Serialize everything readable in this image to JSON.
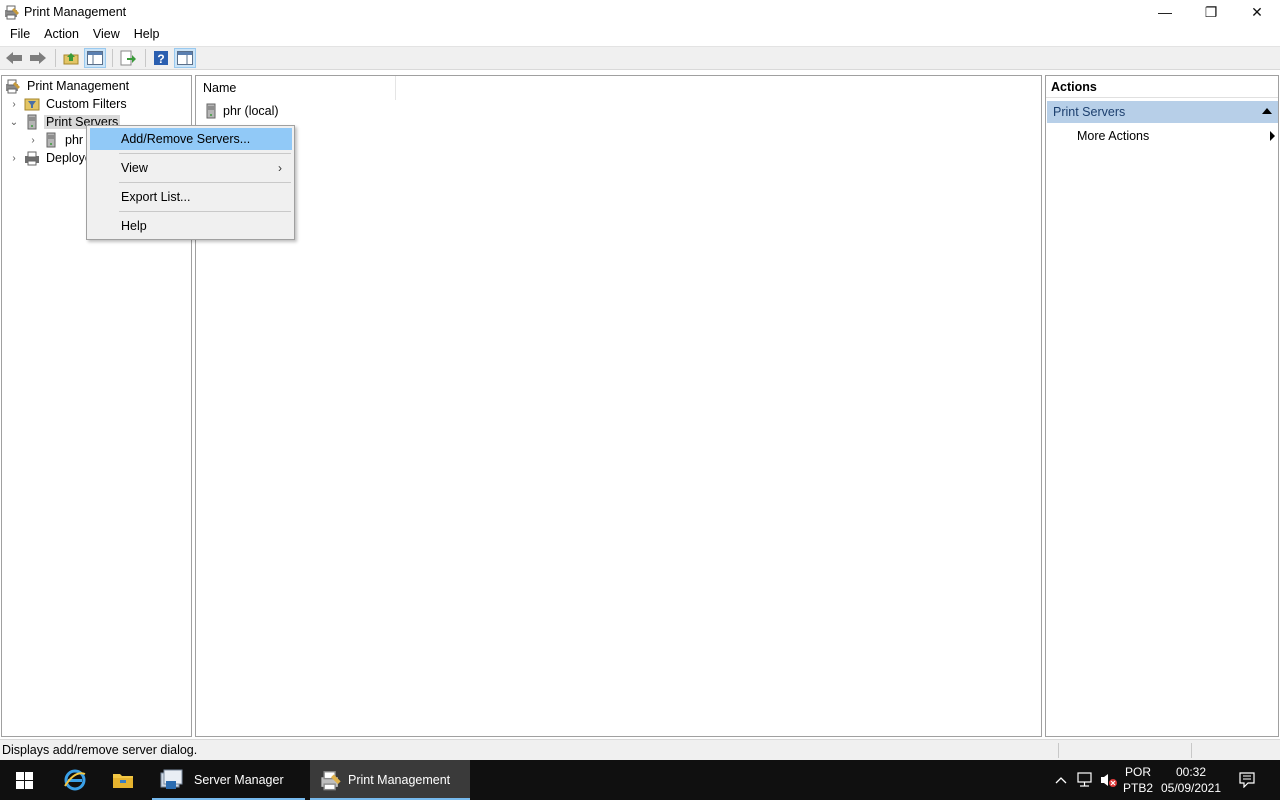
{
  "window": {
    "title": "Print Management",
    "minimize": "—",
    "restore": "❐",
    "close": "✕"
  },
  "menu": [
    "File",
    "Action",
    "View",
    "Help"
  ],
  "tree": {
    "root": "Print Management",
    "custom_filters": "Custom Filters",
    "print_servers": "Print Servers",
    "server_phr": "phr",
    "deployed": "Deploye"
  },
  "list": {
    "column_name": "Name",
    "rows": [
      "phr (local)"
    ]
  },
  "actions": {
    "header": "Actions",
    "section": "Print Servers",
    "more_actions": "More Actions"
  },
  "context_menu": {
    "items": [
      "Add/Remove Servers...",
      "View",
      "Export List...",
      "Help"
    ]
  },
  "status": {
    "text": "Displays add/remove server dialog."
  },
  "taskbar": {
    "apps": [
      "Server Manager",
      "Print Management"
    ],
    "lang_top": "POR",
    "lang_bottom": "PTB2",
    "time": "00:32",
    "date": "05/09/2021"
  },
  "colors": {
    "menu_highlight": "#91c9f7",
    "actions_section_bg": "#b7cfe8",
    "taskbar_bg": "#101010",
    "taskbar_accent": "#76b9ed"
  }
}
